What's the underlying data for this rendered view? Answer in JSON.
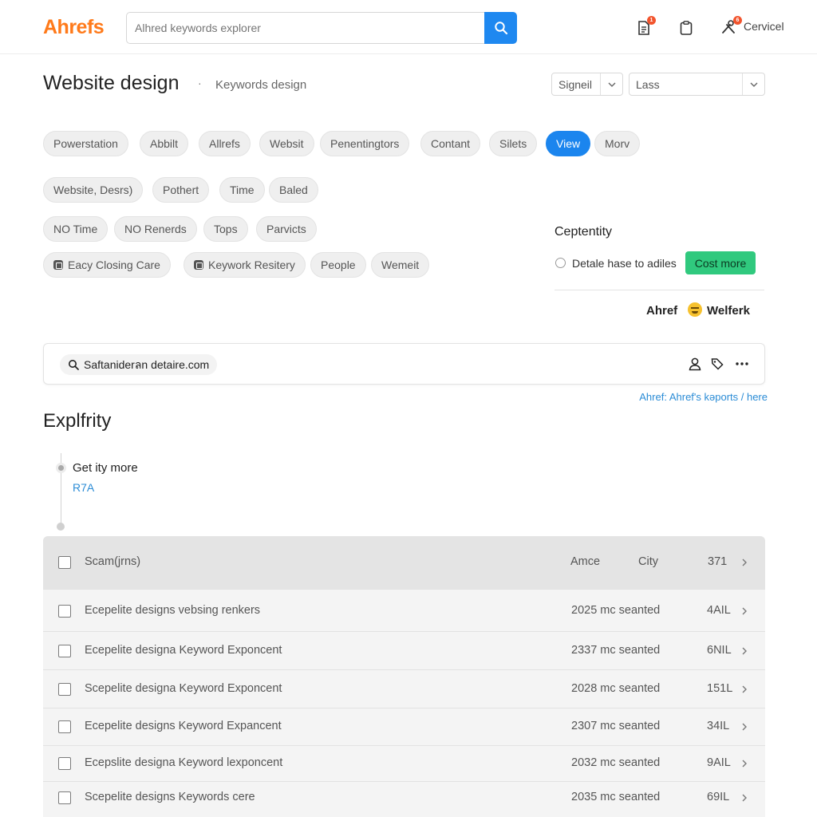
{
  "header": {
    "logo": "Ahrefs",
    "search_placeholder": "Alhred keywords explorer",
    "notif_badge": "1",
    "user_badge": "6",
    "user_label": "Cervicel"
  },
  "title_row": {
    "title": "Website design",
    "separator": "·",
    "subtitle": "Keywords design",
    "select1": "Signeil",
    "select2": "Lass"
  },
  "chips_row1": [
    "Powerstation",
    "Abbilt",
    "Allrefs",
    "Websit",
    "Penentingtors",
    "Contant",
    "Silets",
    "View",
    "Morv"
  ],
  "chips_row2": [
    "Website, Desrs)",
    "Pothert",
    "Time",
    "Baled"
  ],
  "chips_row3": [
    "NO Time",
    "NO Renerds",
    "Tops",
    "Parvicts"
  ],
  "chips_row4": [
    "Eacy Closing Care",
    "Keywork Resitery",
    "People",
    "Wemeit"
  ],
  "panel": {
    "title": "Ceptentity",
    "option_text": "Detale hase to adiles",
    "cta_label": "Cost more",
    "brand": "Ahref",
    "user": "Welferk"
  },
  "site_bar": {
    "domain": "Saftaniderลn detaire.com",
    "report_link": "Ahref: Ahref's kəports / here"
  },
  "section": {
    "title": "Explfrity",
    "timeline_text": "Get ity more",
    "timeline_link": "R7A"
  },
  "table": {
    "header": {
      "name": "Scam(jrns)",
      "col1": "Amce",
      "col2": "City",
      "col3": "371"
    },
    "rows": [
      {
        "name": "Ecepelite designs vebsing renkers",
        "stat": "2025 mc seanted",
        "val": "4AIL"
      },
      {
        "name": "Ecepelite designa Keyword Exponcent",
        "stat": "2337 mc seanted",
        "val": "6NIL"
      },
      {
        "name": "Scepelite designa Keyword Exponcent",
        "stat": "2028 mc seanted",
        "val": "151L"
      },
      {
        "name": "Ecepelite designs Keyword Expancent",
        "stat": "2307 mc seanted",
        "val": "34IL"
      },
      {
        "name": "Ecepslite designa Keyword lexponcent",
        "stat": "2032 mc seanted",
        "val": "9AIL"
      },
      {
        "name": "Scepelite designs Keywords cere",
        "stat": "2035 mc seanted",
        "val": "69IL"
      }
    ]
  },
  "colors": {
    "brand": "#ff7a1a",
    "primary": "#1b85ee",
    "cta": "#30c97e",
    "link": "#2b8cd6",
    "badge": "#f2542d"
  }
}
